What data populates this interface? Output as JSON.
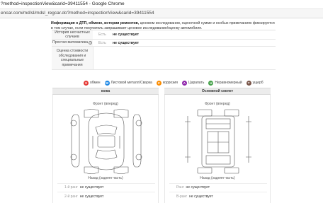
{
  "window": {
    "title": "?method=inspectionView&carid=39411554 - Google Chrome",
    "url": "encar.com/md/sl/mdsl_regcar.do?method=inspectionView&carid=39411554"
  },
  "intro": {
    "bold": "Информация о ДТП, обмене, истории ремонтов,",
    "text": " ценовом исследовании, оценочной сумме и особых примечаниях фиксируется в том случае, если покупатель запрашивает ценовое исследование/оценку автомобиля."
  },
  "history": {
    "rows": [
      {
        "label": "История несчастных случаев",
        "sub": "Есть",
        "value": "не существует"
      },
      {
        "label": "Простая математика",
        "sub": "Есть",
        "value": "не существует"
      },
      {
        "label": "Оценка стоимости обследования и специальные примечания",
        "sub": "",
        "value": ""
      }
    ]
  },
  "legend": [
    {
      "mark": "X",
      "label": "обмен",
      "color": "#e53935"
    },
    {
      "mark": "W",
      "label": "Листовой металл/Сварка",
      "color": "#1e88e5"
    },
    {
      "mark": "C",
      "label": "коррозия",
      "color": "#fb8c00"
    },
    {
      "mark": "A",
      "label": "Царапать",
      "color": "#8e24aa"
    },
    {
      "mark": "U",
      "label": "Неравномерный",
      "color": "#43a047"
    },
    {
      "mark": "T",
      "label": "ущерб",
      "color": "#795548"
    }
  ],
  "panels": {
    "left": {
      "header": "кожа",
      "front": "Фронт (вперед)",
      "rear": "Назад (задняя часть)",
      "ranks": [
        {
          "rank": "1-й ранг",
          "value": "не существует"
        },
        {
          "rank": "2-й ранг",
          "value": "не существует"
        }
      ]
    },
    "right": {
      "header": "Основной скелет",
      "front": "Фронт (вперед)",
      "rear": "Назад (задняя часть)",
      "ranks": [
        {
          "rank": "Ранг",
          "value": "не существует"
        },
        {
          "rank": "В-ранг",
          "value": "не существует"
        }
      ]
    }
  }
}
